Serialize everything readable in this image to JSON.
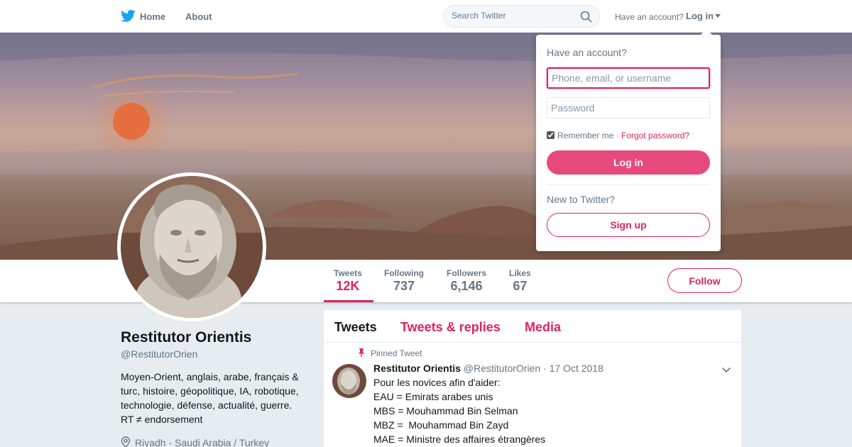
{
  "nav": {
    "home_label": "Home",
    "about_label": "About",
    "search_placeholder": "Search Twitter",
    "have_account": "Have an account?",
    "login_label": "Log in"
  },
  "profile": {
    "name": "Restitutor Orientis",
    "handle": "@RestitutorOrien",
    "bio": "Moyen-Orient, anglais, arabe, français & turc, histoire, géopolitique, IA, robotique, technologie, défense, actualité, guerre. RT ≠ endorsement",
    "location": "Riyadh - Saudi Arabia / Turkey",
    "follow_label": "Follow"
  },
  "stats": [
    {
      "label": "Tweets",
      "value": "12K",
      "active": true
    },
    {
      "label": "Following",
      "value": "737",
      "active": false
    },
    {
      "label": "Followers",
      "value": "6,146",
      "active": false
    },
    {
      "label": "Likes",
      "value": "67",
      "active": false
    }
  ],
  "timeline": {
    "tabs": [
      "Tweets",
      "Tweets & replies",
      "Media"
    ],
    "pinned_label": "Pinned Tweet",
    "tweet": {
      "name": "Restitutor Orientis",
      "meta": "@RestitutorOrien · 17 Oct 2018",
      "text": "Pour les novices afin d'aider:\nEAU = Emirats arabes unis\nMBS = Mouhammad Bin Selman\nMBZ =  Mouhammad Bin Zayd\nMAE = Ministre des affaires étrangères"
    }
  },
  "login_dropdown": {
    "title": "Have an account?",
    "username_placeholder": "Phone, email, or username",
    "password_placeholder": "Password",
    "remember_label": "Remember me",
    "separator": " · ",
    "forgot_label": "Forgot password?",
    "login_button": "Log in",
    "new_prompt": "New to Twitter?",
    "signup_button": "Sign up"
  },
  "colors": {
    "accent": "#e0245e",
    "login_button": "#e8497b",
    "muted": "#657786",
    "background": "#e6ecf0"
  },
  "icons": {
    "logo": "twitter-bird-icon",
    "search": "search-icon",
    "location": "location-pin-icon",
    "pinned": "pushpin-icon",
    "chevron": "chevron-down-icon"
  }
}
